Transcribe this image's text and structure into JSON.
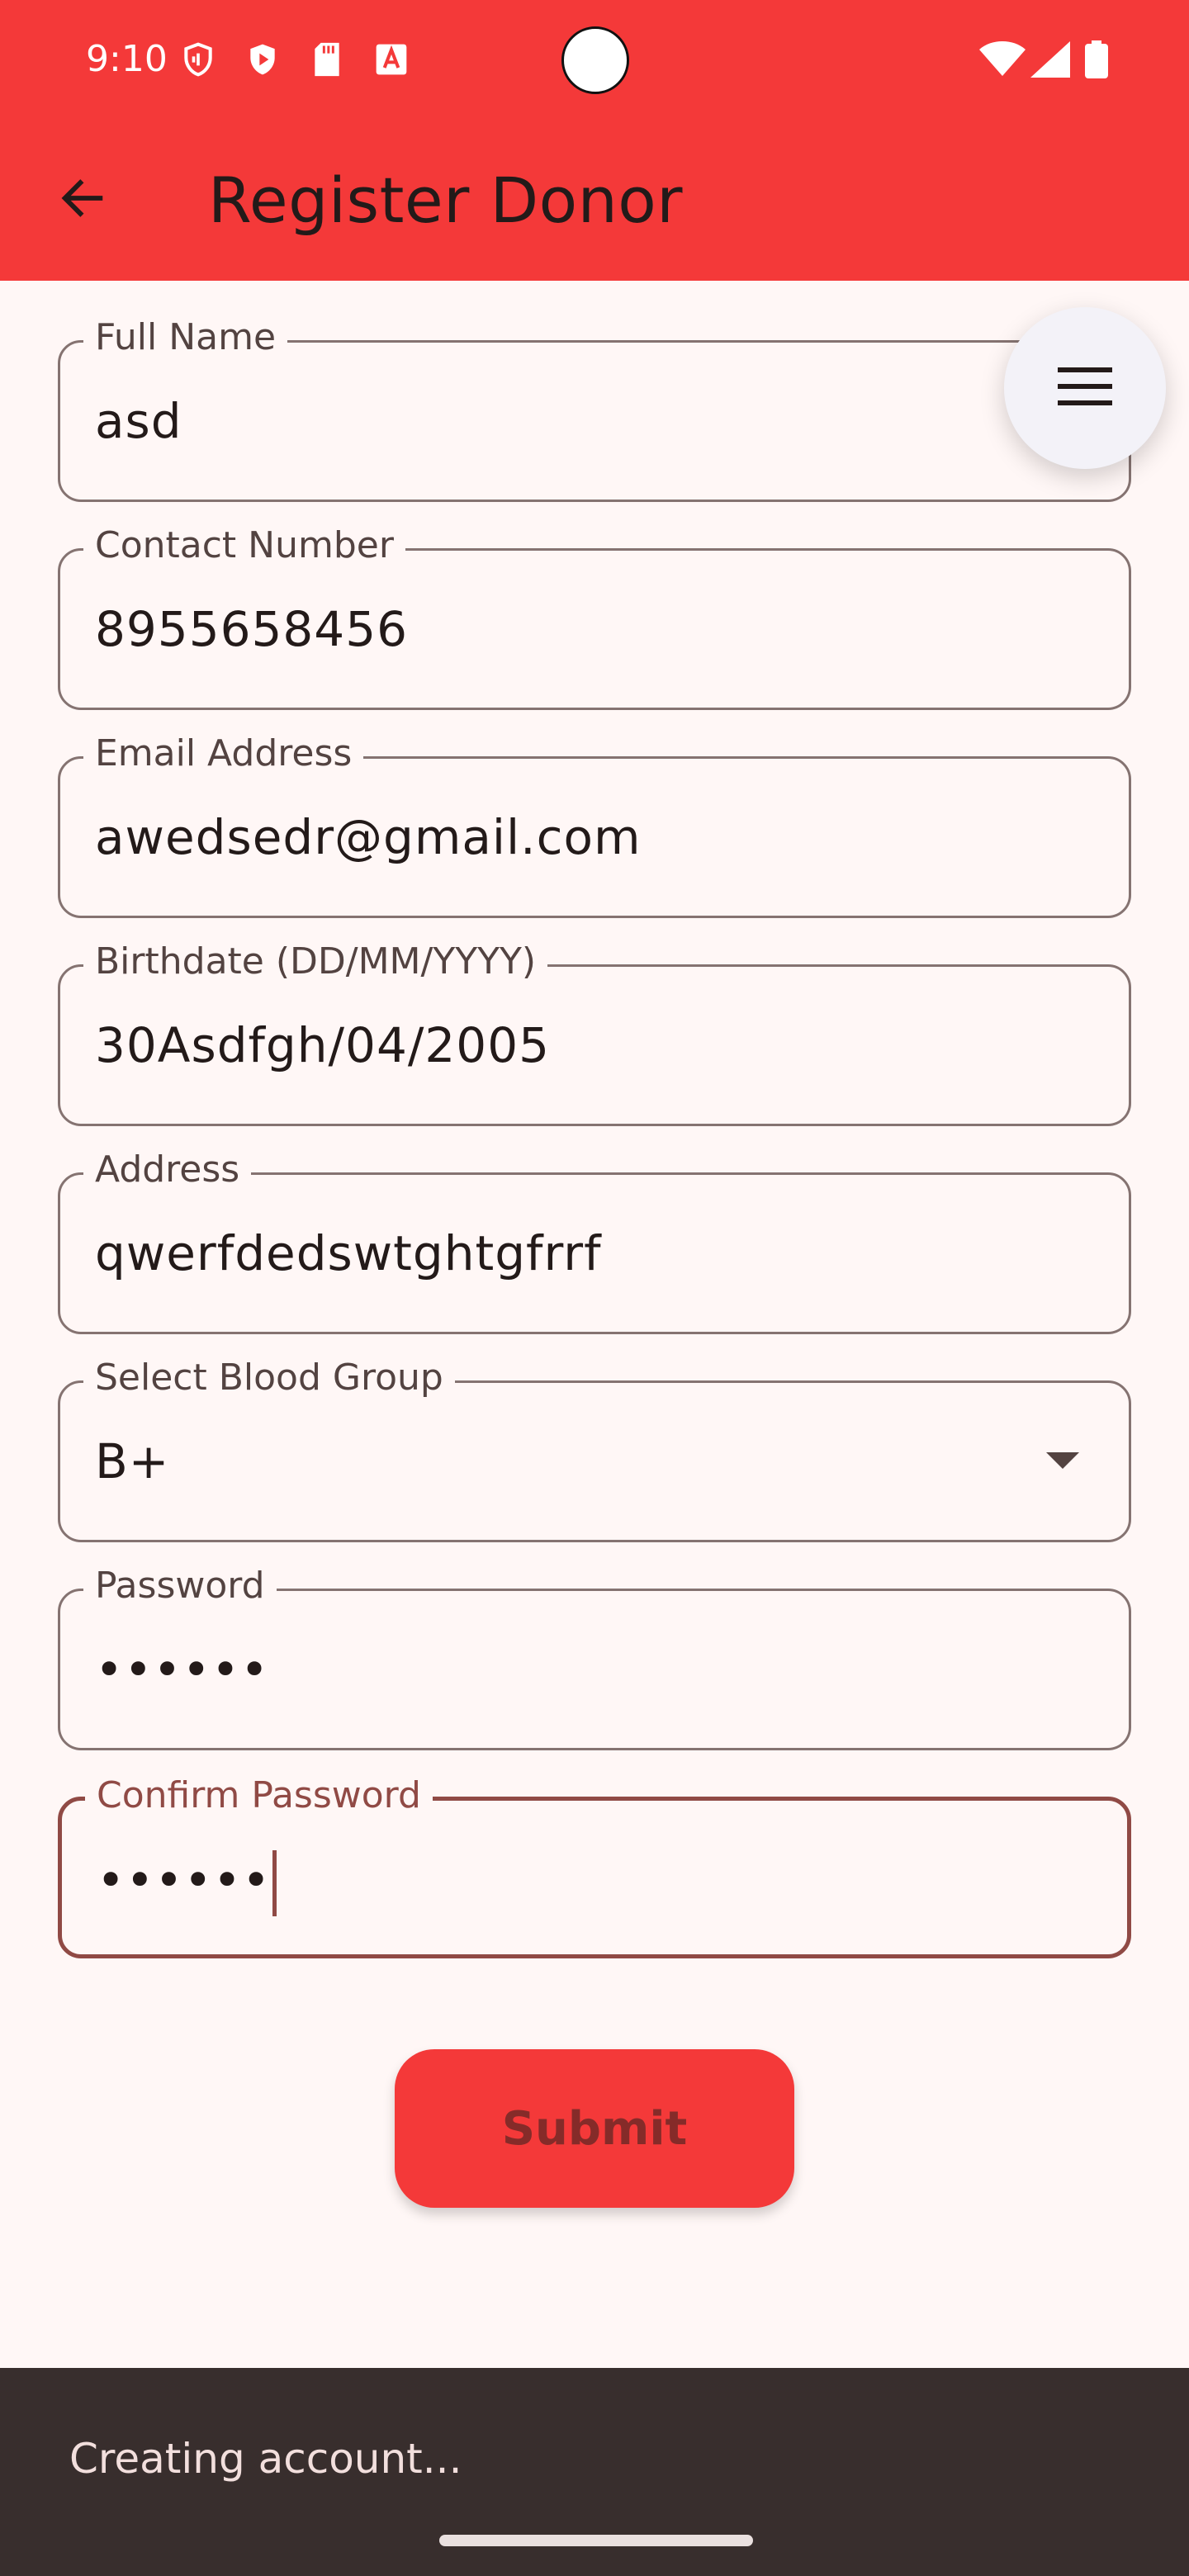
{
  "status_bar": {
    "time": "9:10",
    "left_icons": [
      "shield-icon",
      "play-protect-icon",
      "sd-card-icon",
      "text-a-icon"
    ],
    "right_icons": [
      "wifi-icon",
      "signal-icon",
      "battery-icon"
    ]
  },
  "app_bar": {
    "title": "Register Donor",
    "back_icon": "arrow-left-icon"
  },
  "menu": {
    "icon": "hamburger-icon"
  },
  "form": {
    "full_name": {
      "label": "Full Name",
      "value": "asd"
    },
    "contact_number": {
      "label": "Contact Number",
      "value": "8955658456"
    },
    "email": {
      "label": "Email Address",
      "value": "awedsedr@gmail.com"
    },
    "birthdate": {
      "label": "Birthdate (DD/MM/YYYY)",
      "value": "30Asdfgh/04/2005"
    },
    "address": {
      "label": "Address",
      "value": "qwerfdedswtghtgfrrf"
    },
    "blood_group": {
      "label": "Select Blood Group",
      "value": "B+"
    },
    "password": {
      "label": "Password",
      "value": "••••••"
    },
    "confirm_password": {
      "label": "Confirm Password",
      "value": "••••••"
    }
  },
  "submit": {
    "label": "Submit"
  },
  "snackbar": {
    "text": "Creating account..."
  },
  "colors": {
    "primary": "#f43939",
    "background": "#fff7f6",
    "outline": "#857371",
    "focused_outline": "#904a45",
    "snackbar": "#382e2d"
  }
}
